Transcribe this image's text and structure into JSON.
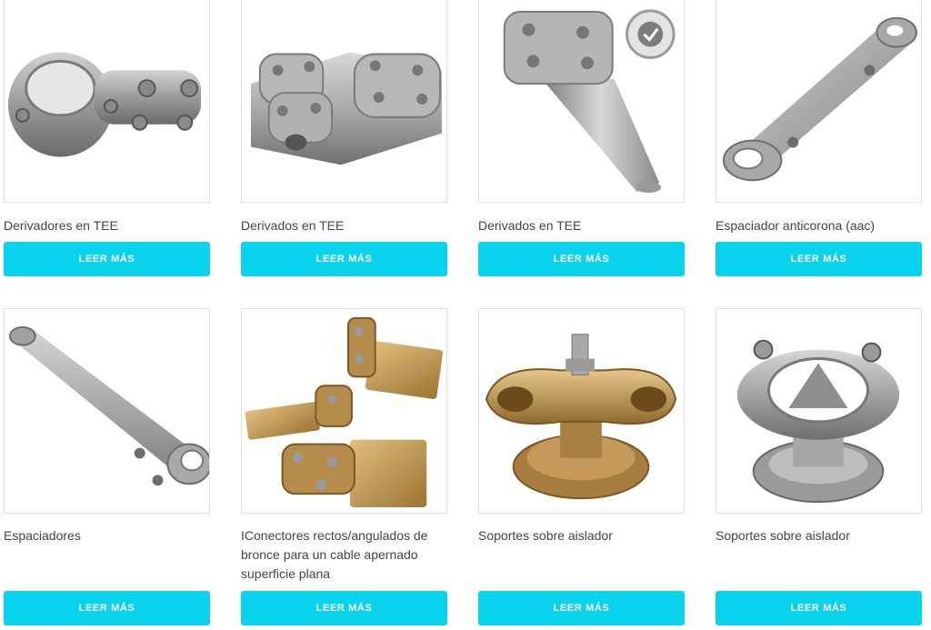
{
  "products": [
    {
      "title": "Derivadores en TEE",
      "button": "LEER MÁS",
      "image": "tee-connector-large-clamp"
    },
    {
      "title": "Derivados en TEE",
      "button": "LEER MÁS",
      "image": "tee-connector-multi-clamp"
    },
    {
      "title": "Derivados en TEE",
      "button": "LEER MÁS",
      "image": "tee-connector-with-rod"
    },
    {
      "title": "Espaciador anticorona (aac)",
      "button": "LEER MÁS",
      "image": "anticorona-spacer"
    },
    {
      "title": "Espaciadores",
      "button": "LEER MÁS",
      "image": "spacer-bar"
    },
    {
      "title": "IConectores rectos/angulados de bronce para un cable apernado superficie plana",
      "button": "LEER MÁS",
      "image": "bronze-flat-connectors"
    },
    {
      "title": "Soportes sobre aislador",
      "button": "LEER MÁS",
      "image": "bronze-insulator-support"
    },
    {
      "title": "Soportes sobre aislador",
      "button": "LEER MÁS",
      "image": "aluminum-insulator-support"
    }
  ],
  "colors": {
    "button": "#09d3ec",
    "button_text": "#ffffff",
    "title": "#444444",
    "border": "#e1e1e1"
  }
}
